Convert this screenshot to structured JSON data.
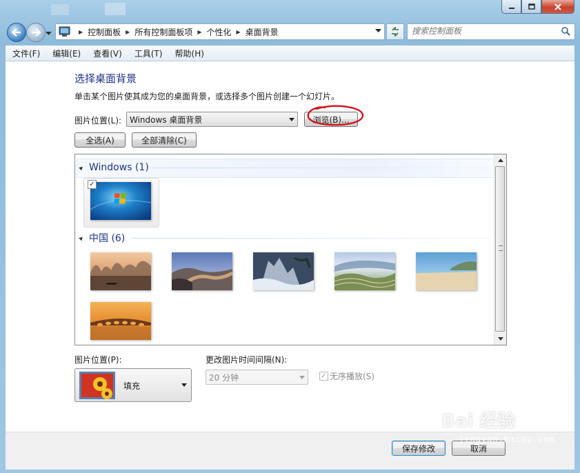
{
  "window": {
    "breadcrumbs": [
      "控制面板",
      "所有控制面板项",
      "个性化",
      "桌面背景"
    ],
    "search_placeholder": "搜索控制面板"
  },
  "menu": [
    "文件(F)",
    "编辑(E)",
    "查看(V)",
    "工具(T)",
    "帮助(H)"
  ],
  "main": {
    "heading": "选择桌面背景",
    "description": "单击某个图片使其成为您的桌面背景，或选择多个图片创建一个幻灯片。",
    "picture_location_label": "图片位置(L):",
    "picture_location_value": "Windows 桌面背景",
    "browse_button": "浏览(B)...",
    "select_all_button": "全选(A)",
    "clear_all_button": "全部清除(C)"
  },
  "gallery": {
    "groups": [
      {
        "name": "Windows (1)",
        "items": [
          {
            "name": "windows-7-default",
            "checked": true
          }
        ]
      },
      {
        "name": "中国 (6)",
        "items": [
          {
            "name": "guilin-karst-river",
            "checked": false
          },
          {
            "name": "great-wall",
            "checked": false
          },
          {
            "name": "huangshan-mountains",
            "checked": false
          },
          {
            "name": "rice-terraces",
            "checked": false
          },
          {
            "name": "beach-sand",
            "checked": false
          },
          {
            "name": "seventeen-arch-bridge",
            "checked": false
          }
        ]
      }
    ]
  },
  "bottom": {
    "position_label": "图片位置(P):",
    "position_value": "填充",
    "interval_label": "更改图片时间间隔(N):",
    "interval_value": "20 分钟",
    "shuffle_label": "无序播放(S)",
    "shuffle_checked": true
  },
  "footer": {
    "save_button": "保存修改",
    "cancel_button": "取消"
  },
  "watermark": {
    "text": "Bai 经验",
    "sub": "jingyan.baidu.com"
  },
  "colors": {
    "heading": "#1e3287",
    "annotation": "#d0141e"
  }
}
